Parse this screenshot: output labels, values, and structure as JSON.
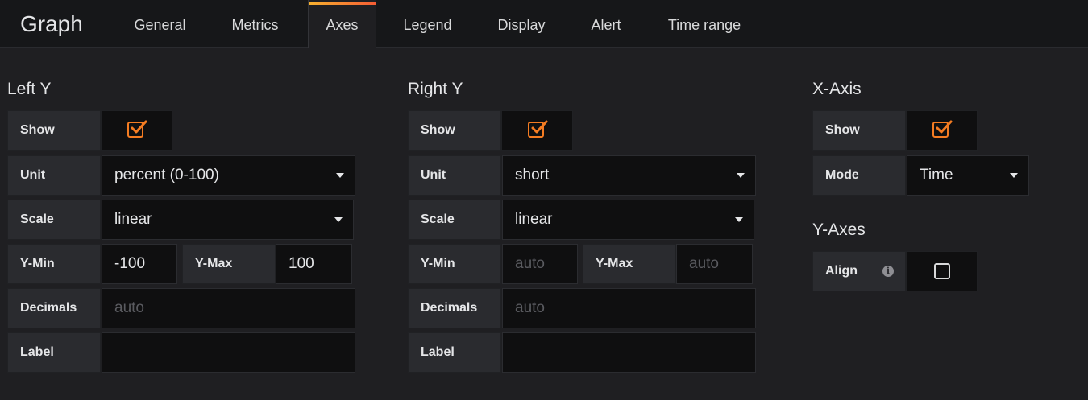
{
  "panel": {
    "title": "Graph"
  },
  "tabs": [
    {
      "label": "General"
    },
    {
      "label": "Metrics"
    },
    {
      "label": "Axes",
      "active": true
    },
    {
      "label": "Legend"
    },
    {
      "label": "Display"
    },
    {
      "label": "Alert"
    },
    {
      "label": "Time range"
    }
  ],
  "left_y": {
    "title": "Left Y",
    "show_label": "Show",
    "show_checked": true,
    "unit_label": "Unit",
    "unit_value": "percent (0-100)",
    "scale_label": "Scale",
    "scale_value": "linear",
    "ymin_label": "Y-Min",
    "ymin_value": "-100",
    "ymax_label": "Y-Max",
    "ymax_value": "100",
    "decimals_label": "Decimals",
    "decimals_placeholder": "auto",
    "label_label": "Label",
    "label_value": ""
  },
  "right_y": {
    "title": "Right Y",
    "show_label": "Show",
    "show_checked": true,
    "unit_label": "Unit",
    "unit_value": "short",
    "scale_label": "Scale",
    "scale_value": "linear",
    "ymin_label": "Y-Min",
    "ymin_placeholder": "auto",
    "ymax_label": "Y-Max",
    "ymax_placeholder": "auto",
    "decimals_label": "Decimals",
    "decimals_placeholder": "auto",
    "label_label": "Label",
    "label_value": ""
  },
  "x_axis": {
    "title": "X-Axis",
    "show_label": "Show",
    "show_checked": true,
    "mode_label": "Mode",
    "mode_value": "Time"
  },
  "y_axes": {
    "title": "Y-Axes",
    "align_label": "Align",
    "align_checked": false
  },
  "colors": {
    "accent": "#f47c22",
    "tab_gradient_start": "#f7b12f",
    "tab_gradient_end": "#f55d34"
  }
}
